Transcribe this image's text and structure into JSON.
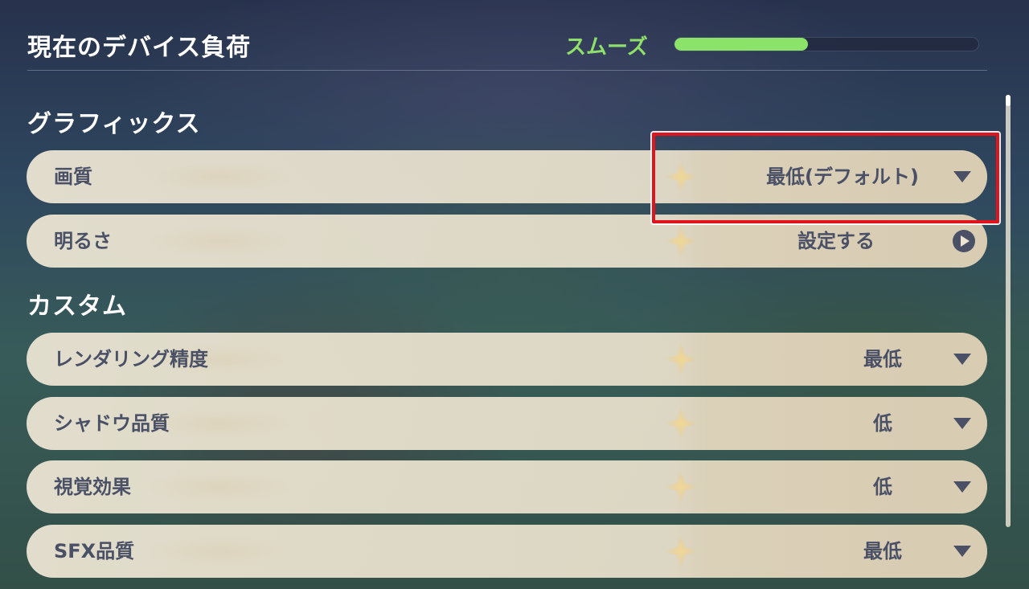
{
  "header": {
    "title": "現在のデバイス負荷",
    "load_status": "スムーズ",
    "load_level": 0.44,
    "load_color": "#8be36a"
  },
  "sections": {
    "graphics": {
      "title": "グラフィックス"
    },
    "custom": {
      "title": "カスタム"
    }
  },
  "rows": {
    "quality": {
      "label": "画質",
      "value": "最低(デフォルト)",
      "icon": "chevron-down-icon"
    },
    "brightness": {
      "label": "明るさ",
      "value": "設定する",
      "icon": "arrow-right-circle-icon"
    },
    "render": {
      "label": "レンダリング精度",
      "value": "最低",
      "icon": "chevron-down-icon"
    },
    "shadow": {
      "label": "シャドウ品質",
      "value": "低",
      "icon": "chevron-down-icon"
    },
    "visual": {
      "label": "視覚効果",
      "value": "低",
      "icon": "chevron-down-icon"
    },
    "sfx": {
      "label": "SFX品質",
      "value": "最低",
      "icon": "chevron-down-icon"
    }
  },
  "colors": {
    "highlight": "#e0141c",
    "text_dark": "#4a5065",
    "status_green": "#8fe06a"
  }
}
